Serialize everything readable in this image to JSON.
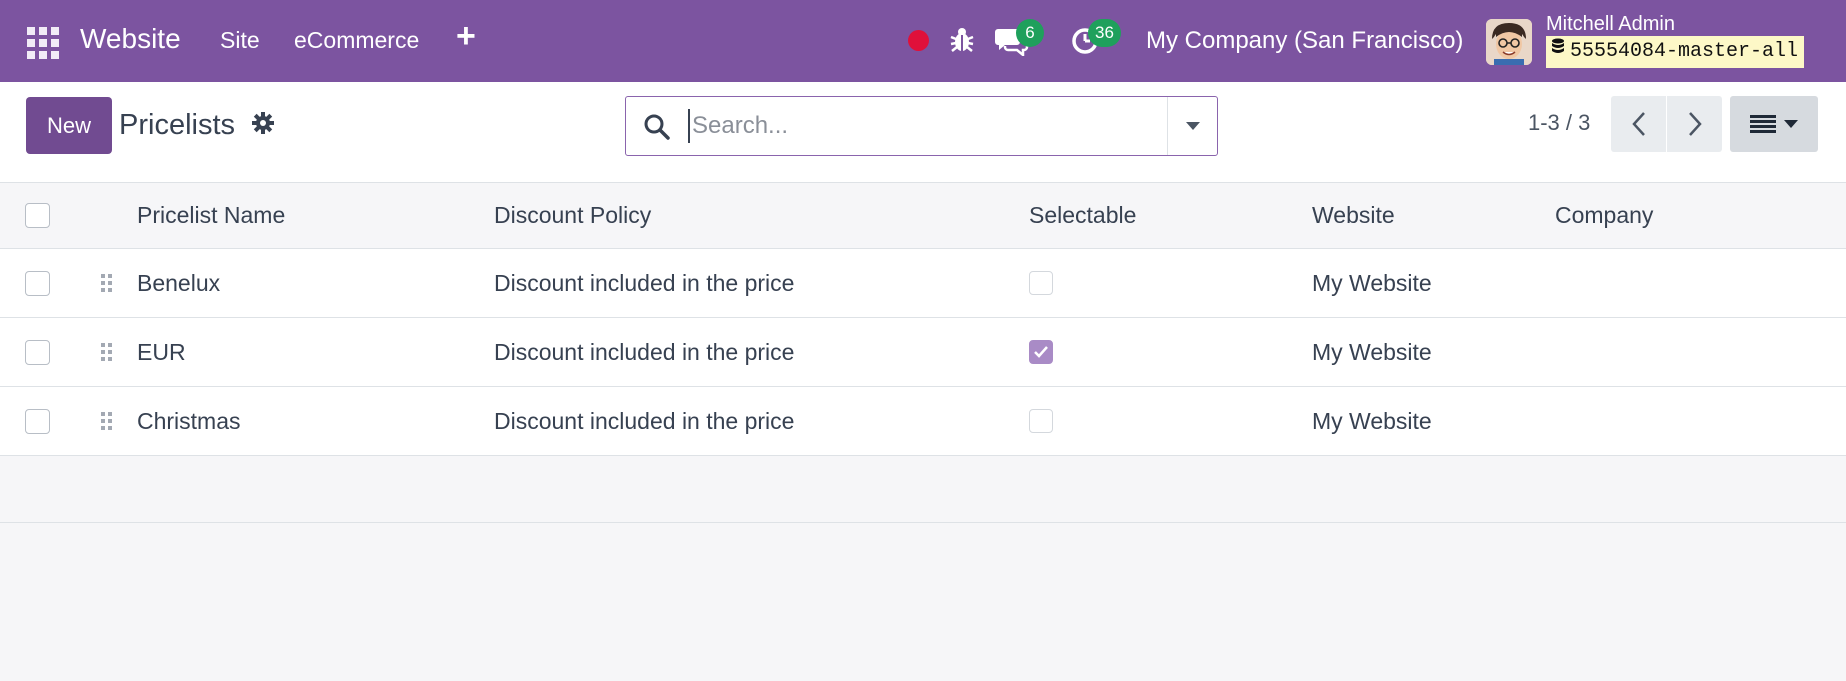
{
  "navbar": {
    "brand": "Website",
    "menu": [
      "Site",
      "eCommerce"
    ],
    "messages_count": "6",
    "activities_count": "36",
    "company": "My Company (San Francisco)",
    "user_name": "Mitchell Admin",
    "database": "55554084-master-all",
    "colors": {
      "bar": "#7c54a0",
      "badge": "#1fa05c",
      "record": "#e0103a"
    }
  },
  "control_panel": {
    "new_label": "New",
    "title": "Pricelists",
    "search_placeholder": "Search...",
    "pager": "1-3 / 3"
  },
  "table": {
    "columns": [
      "Pricelist Name",
      "Discount Policy",
      "Selectable",
      "Website",
      "Company"
    ],
    "rows": [
      {
        "name": "Benelux",
        "policy": "Discount included in the price",
        "selectable": false,
        "website": "My Website",
        "company": ""
      },
      {
        "name": "EUR",
        "policy": "Discount included in the price",
        "selectable": true,
        "website": "My Website",
        "company": ""
      },
      {
        "name": "Christmas",
        "policy": "Discount included in the price",
        "selectable": false,
        "website": "My Website",
        "company": ""
      }
    ]
  },
  "icons": [
    "apps-icon",
    "plus-icon",
    "bug-icon",
    "chat-icon",
    "clock-icon",
    "database-icon",
    "gear-icon",
    "search-icon",
    "chevron-left-icon",
    "chevron-right-icon",
    "list-view-icon"
  ]
}
